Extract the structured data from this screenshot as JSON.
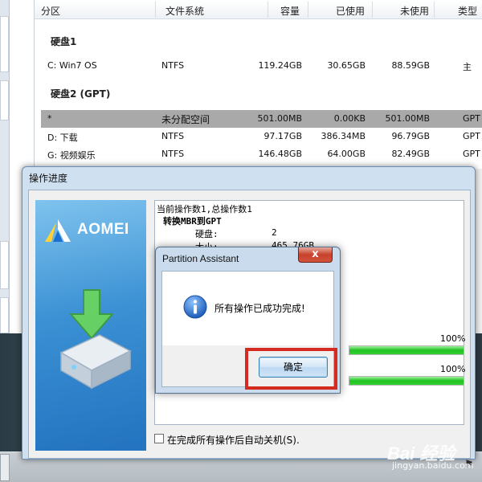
{
  "partition_list": {
    "columns": [
      "分区",
      "文件系统",
      "容量",
      "已使用",
      "未使用",
      "类型"
    ],
    "disks": [
      {
        "label": "硬盘1",
        "rows": [
          {
            "name": "C: Win7 OS",
            "fs": "NTFS",
            "capacity": "119.24GB",
            "used": "30.65GB",
            "free": "88.59GB",
            "type": "主"
          }
        ]
      },
      {
        "label": "硬盘2 (GPT)",
        "rows": [
          {
            "name": "*",
            "fs": "未分配空间",
            "capacity": "501.00MB",
            "used": "0.00KB",
            "free": "501.00MB",
            "type": "GPT",
            "selected": true
          },
          {
            "name": "D: 下载",
            "fs": "NTFS",
            "capacity": "97.17GB",
            "used": "386.34MB",
            "free": "96.79GB",
            "type": "GPT"
          },
          {
            "name": "G: 视频娱乐",
            "fs": "NTFS",
            "capacity": "146.48GB",
            "used": "64.00GB",
            "free": "82.49GB",
            "type": "GPT"
          }
        ]
      }
    ]
  },
  "progress_window": {
    "title": "操作进度",
    "brand": "AOMEI",
    "log": {
      "line1": "当前操作数1,总操作数1",
      "line2": "转换MBR到GPT",
      "disk_key": "硬盘:",
      "disk_val": "2",
      "size_key": "大小:",
      "size_val": "465.76GB"
    },
    "progress": [
      {
        "label": "100%",
        "value": 100
      },
      {
        "label": "100%",
        "value": 100
      }
    ],
    "shutdown_label": "在完成所有操作后自动关机(S)."
  },
  "message_box": {
    "title": "Partition Assistant",
    "close_glyph": "x",
    "message": "所有操作已成功完成!",
    "ok_label": "确定"
  },
  "watermark": {
    "main": "Bai 经验",
    "sub": "jingyan.baidu.com"
  },
  "colors": {
    "accent": "#3c7fb1",
    "highlight": "#d42a1f",
    "progress": "#1fc21f",
    "selected_row": "#a9a9a9"
  }
}
